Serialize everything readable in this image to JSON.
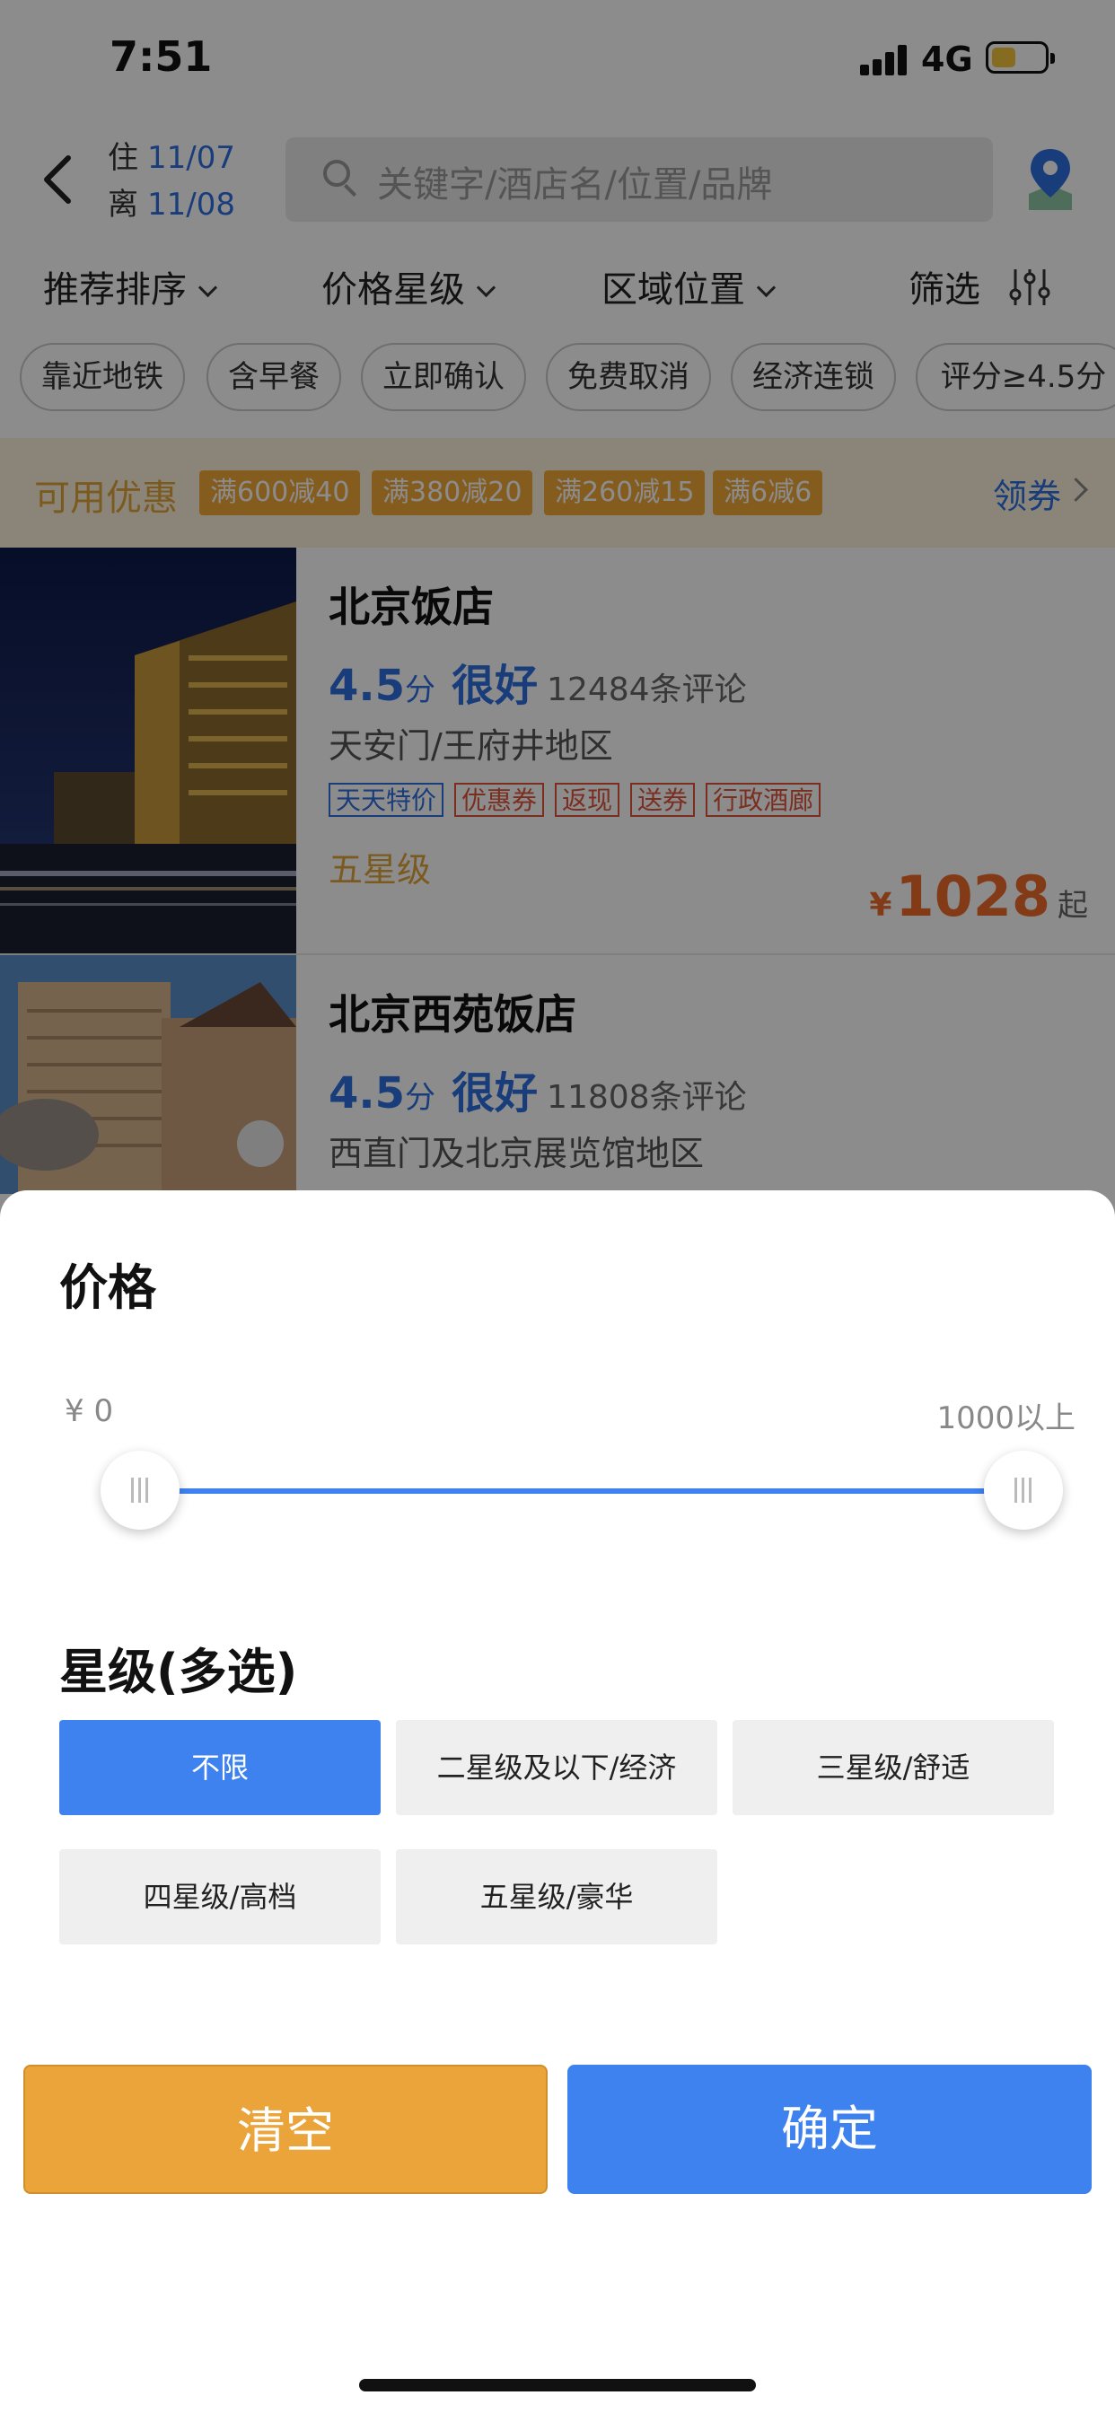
{
  "status_bar": {
    "time": "7:51",
    "network": "4G",
    "battery_color": "#f2c53d"
  },
  "header": {
    "checkin_label": "住",
    "checkin_date": "11/07",
    "checkout_label": "离",
    "checkout_date": "11/08",
    "search_placeholder": "关键字/酒店名/位置/品牌",
    "back_icon": "chevron-left-icon",
    "map_icon": "map-pin-icon"
  },
  "filters": [
    {
      "label": "推荐排序"
    },
    {
      "label": "价格星级"
    },
    {
      "label": "区域位置"
    },
    {
      "label": "筛选"
    }
  ],
  "chips": [
    "靠近地铁",
    "含早餐",
    "立即确认",
    "免费取消",
    "经济连锁",
    "评分≥4.5分"
  ],
  "promo": {
    "title": "可用优惠",
    "coupons": [
      "满600减40",
      "满380减20",
      "满260减15",
      "满6减6"
    ],
    "action": "领券"
  },
  "hotels": [
    {
      "name": "北京饭店",
      "score": "4.5",
      "score_unit": "分",
      "rating_word": "很好",
      "reviews": "12484条评论",
      "area": "天安门/王府井地区",
      "tags": [
        {
          "text": "天天特价",
          "color": "#2f6fe0"
        },
        {
          "text": "优惠券",
          "color": "#e0553a"
        },
        {
          "text": "返现",
          "color": "#e0553a"
        },
        {
          "text": "送券",
          "color": "#e0553a"
        },
        {
          "text": "行政酒廊",
          "color": "#e0553a"
        }
      ],
      "star": "五星级",
      "currency": "¥",
      "price": "1028",
      "price_suffix": "起"
    },
    {
      "name": "北京西苑饭店",
      "score": "4.5",
      "score_unit": "分",
      "rating_word": "很好",
      "reviews": "11808条评论",
      "area": "西直门及北京展览馆地区"
    }
  ],
  "sheet": {
    "price_title": "价格",
    "price_min_label": "¥ 0",
    "price_max_label": "1000以上",
    "price_range_fraction": [
      0,
      1
    ],
    "star_title": "星级(多选)",
    "star_options": [
      {
        "label": "不限",
        "selected": true
      },
      {
        "label": "二星级及以下/经济",
        "selected": false
      },
      {
        "label": "三星级/舒适",
        "selected": false
      },
      {
        "label": "四星级/高档",
        "selected": false
      },
      {
        "label": "五星级/豪华",
        "selected": false
      }
    ],
    "clear_label": "清空",
    "confirm_label": "确定"
  },
  "colors": {
    "accent_blue": "#3e82ef",
    "accent_orange": "#eaa43a",
    "price_orange": "#ef6c2a"
  }
}
